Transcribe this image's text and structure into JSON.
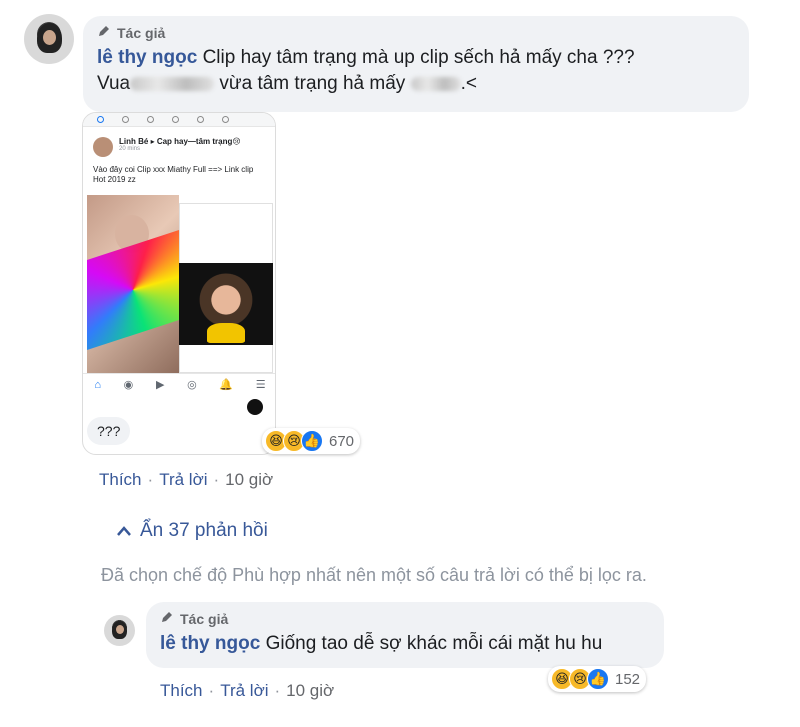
{
  "comment1": {
    "author_tag": "Tác giả",
    "author_name": "lê thy ngọc",
    "text_line1": "Clip hay tâm trạng mà up clip sếch hả mấy cha ???",
    "text_line2_prefix": "Vua",
    "text_line2_mid": "vừa tâm trạng hả mấy",
    "text_line2_suffix": ".<",
    "attachment": {
      "post_name": "Linh Bé",
      "post_group": "Cap hay—tâm trạng😢",
      "post_time": "20 mins",
      "post_text": "Vào đây coi Clip xxx Miathy Full ==> Link clip Hot 2019 zz",
      "reply_text": "???"
    },
    "reactions": {
      "count": "670",
      "icons": [
        "haha-icon",
        "sad-icon",
        "like-icon"
      ]
    },
    "actions": {
      "like": "Thích",
      "reply": "Trả lời",
      "time": "10 giờ"
    }
  },
  "hide_replies": {
    "label": "Ẩn 37 phản hồi",
    "icon": "chevron-up-icon"
  },
  "filter_note": "Đã chọn chế độ Phù hợp nhất nên một số câu trả lời có thể bị lọc ra.",
  "reply1": {
    "author_tag": "Tác giả",
    "author_name": "lê thy ngọc",
    "text": "Giống tao dễ sợ khác mỗi cái mặt hu hu",
    "reactions": {
      "count": "152",
      "icons": [
        "haha-icon",
        "sad-icon",
        "like-icon"
      ]
    },
    "actions": {
      "like": "Thích",
      "reply": "Trả lời",
      "time": "10 giờ"
    }
  },
  "colors": {
    "link": "#385898",
    "name": "#365899",
    "bubble": "#f0f2f5",
    "muted": "#65676b"
  }
}
